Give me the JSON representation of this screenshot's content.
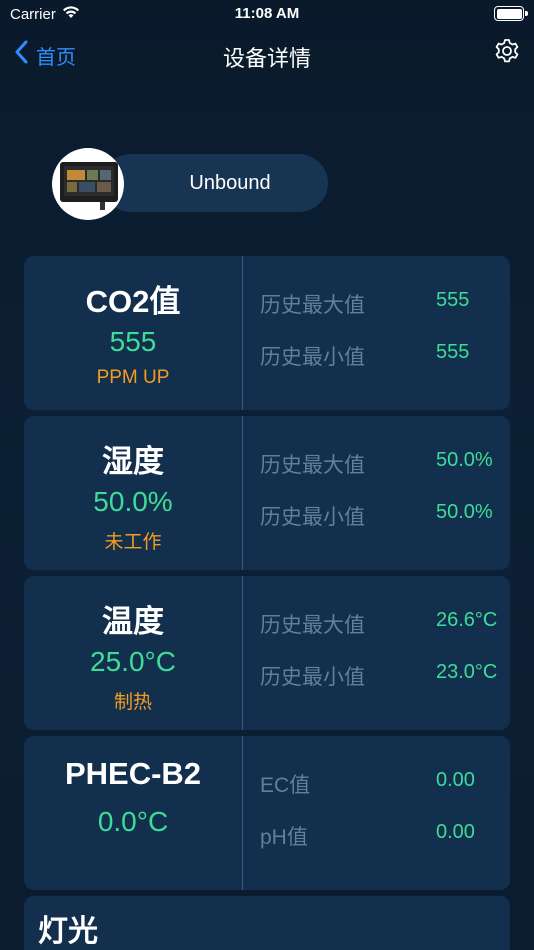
{
  "status_bar": {
    "carrier": "Carrier",
    "time": "11:08 AM"
  },
  "nav": {
    "back_label": "首页",
    "title": "设备详情"
  },
  "device": {
    "status": "Unbound"
  },
  "cards": [
    {
      "name": "CO2值",
      "value": "555",
      "status": "PPM UP",
      "rows": [
        {
          "label": "历史最大值",
          "value": "555"
        },
        {
          "label": "历史最小值",
          "value": "555"
        }
      ]
    },
    {
      "name": "湿度",
      "value": "50.0%",
      "status": "未工作",
      "rows": [
        {
          "label": "历史最大值",
          "value": "50.0%"
        },
        {
          "label": "历史最小值",
          "value": "50.0%"
        }
      ]
    },
    {
      "name": "温度",
      "value": "25.0°C",
      "status": "制热",
      "rows": [
        {
          "label": "历史最大值",
          "value": "26.6°C"
        },
        {
          "label": "历史最小值",
          "value": "23.0°C"
        }
      ]
    },
    {
      "name": "PHEC-B2",
      "value": "0.0°C",
      "status": "",
      "rows": [
        {
          "label": "EC值",
          "value": "0.00"
        },
        {
          "label": "pH值",
          "value": "0.00"
        }
      ]
    }
  ],
  "light_section": {
    "title": "灯光"
  },
  "colors": {
    "accent_blue": "#2f8dff",
    "value_green": "#3ddc97",
    "status_orange": "#f39c1f",
    "card_bg": "#132f4e"
  },
  "icons": {
    "back": "chevron-left-icon",
    "settings": "gear-icon",
    "wifi": "wifi-icon",
    "battery": "battery-icon"
  }
}
